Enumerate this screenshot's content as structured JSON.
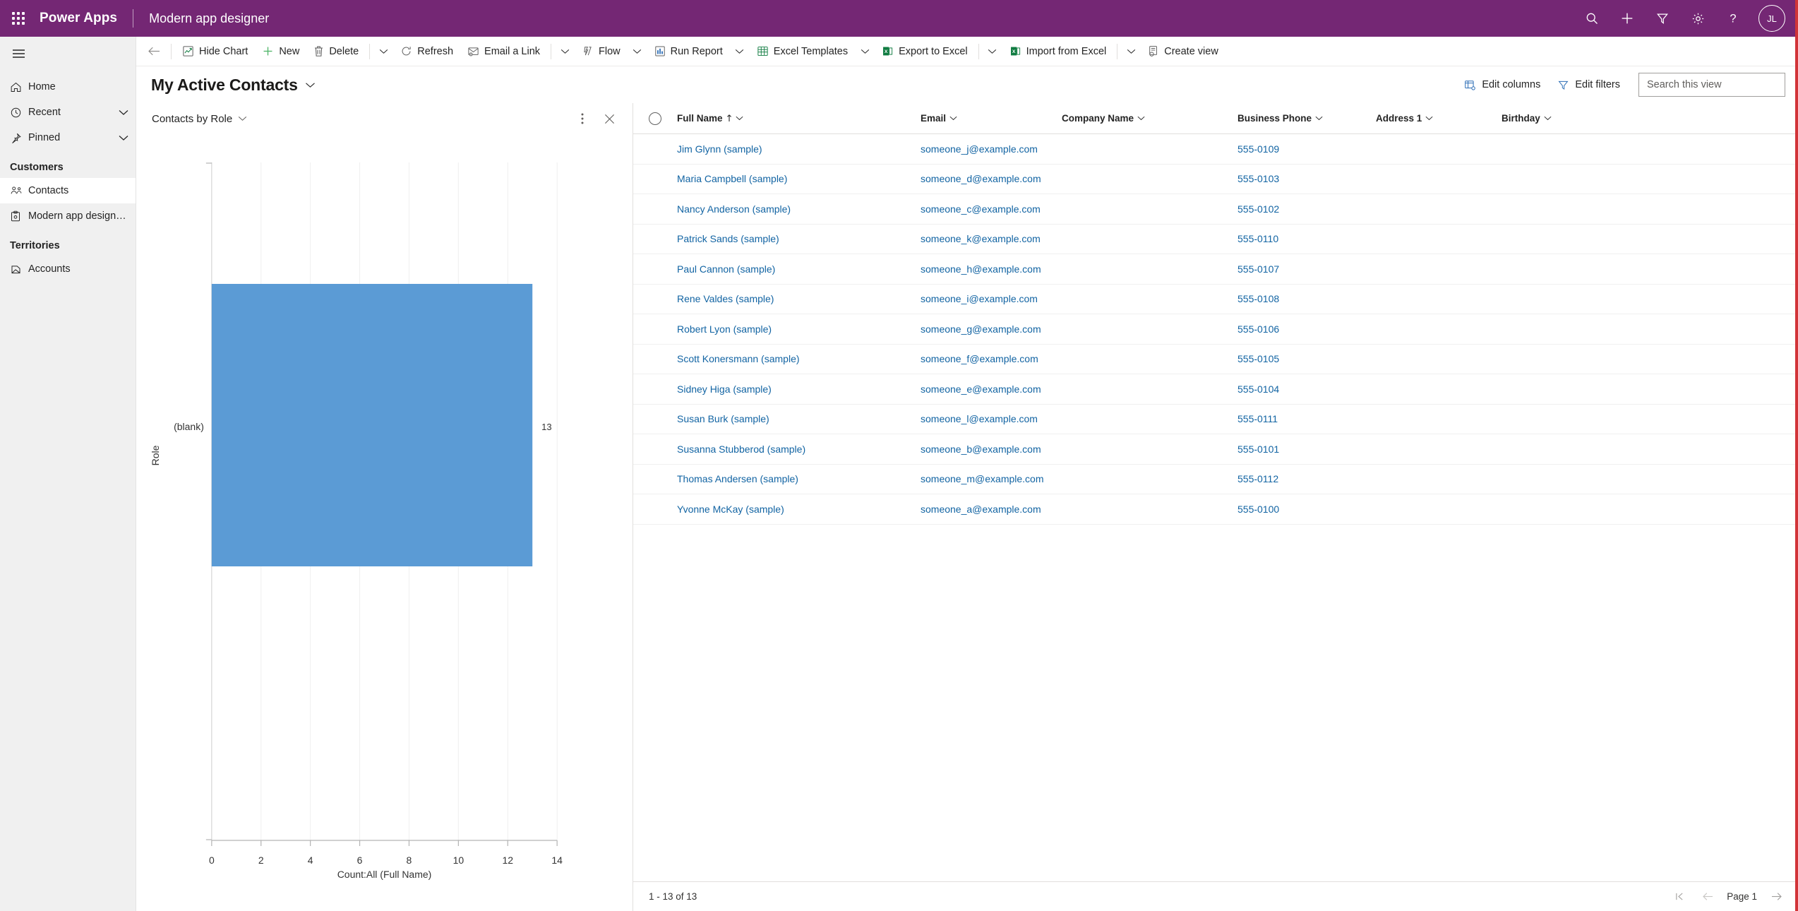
{
  "topbar": {
    "waffle_label": "app-launcher",
    "brand": "Power Apps",
    "app_name": "Modern app designer",
    "icons": [
      "search-icon",
      "plus-icon",
      "filter-icon",
      "gear-icon",
      "help-icon"
    ],
    "avatar_initials": "JL",
    "bg_color": "#742774"
  },
  "sidebar": {
    "hamburger": "site-map-toggle",
    "items": [
      {
        "label": "Home",
        "icon": "home-icon",
        "expandable": false,
        "active": false
      },
      {
        "label": "Recent",
        "icon": "clock-icon",
        "expandable": true,
        "active": false
      },
      {
        "label": "Pinned",
        "icon": "pin-icon",
        "expandable": true,
        "active": false
      }
    ],
    "groups": [
      {
        "title": "Customers",
        "items": [
          {
            "label": "Contacts",
            "icon": "contacts-icon",
            "active": true
          },
          {
            "label": "Modern app designe...",
            "icon": "clipboard-icon",
            "active": false
          }
        ]
      },
      {
        "title": "Territories",
        "items": [
          {
            "label": "Accounts",
            "icon": "accounts-icon",
            "active": false
          }
        ]
      }
    ]
  },
  "commandbar": {
    "back": "back-arrow-icon",
    "commands": [
      {
        "label": "Hide Chart",
        "icon": "chart-icon",
        "caret": false
      },
      {
        "label": "New",
        "icon": "plus-icon",
        "caret": false
      },
      {
        "label": "Delete",
        "icon": "trash-icon",
        "caret": true,
        "divider_before": false,
        "divider_after": true
      },
      {
        "label": "Refresh",
        "icon": "refresh-icon",
        "caret": false
      },
      {
        "label": "Email a Link",
        "icon": "email-link-icon",
        "caret": true
      },
      {
        "label": "Flow",
        "icon": "flow-icon",
        "caret": true
      },
      {
        "label": "Run Report",
        "icon": "report-icon",
        "caret": true
      },
      {
        "label": "Excel Templates",
        "icon": "excel-templates-icon",
        "caret": true
      },
      {
        "label": "Export to Excel",
        "icon": "excel-icon",
        "caret": true
      },
      {
        "label": "Import from Excel",
        "icon": "excel-icon",
        "caret": true
      },
      {
        "label": "Create view",
        "icon": "create-view-icon",
        "caret": false
      }
    ]
  },
  "view": {
    "title": "My Active Contacts",
    "title_caret": "chevron-down-icon",
    "edit_columns_label": "Edit columns",
    "edit_filters_label": "Edit filters",
    "search_placeholder": "Search this view",
    "search_value": ""
  },
  "chart_panel": {
    "title": "Contacts by Role",
    "title_caret": "chevron-down-icon",
    "more_icon": "more-vertical-icon",
    "close_icon": "close-icon"
  },
  "chart_data": {
    "type": "bar",
    "orientation": "horizontal",
    "title": "Contacts by Role",
    "categories": [
      "(blank)"
    ],
    "values": [
      13
    ],
    "data_labels": [
      "13"
    ],
    "xlabel": "Count:All (Full Name)",
    "ylabel": "Role",
    "xlim": [
      0,
      14
    ],
    "xticks": [
      0,
      2,
      4,
      6,
      8,
      10,
      12,
      14
    ],
    "xtick_labels": [
      "0",
      "2",
      "4",
      "6",
      "8",
      "10",
      "12",
      "14"
    ],
    "grid": true,
    "grid_axis": "x",
    "legend": false,
    "bar_color": "#5B9BD5"
  },
  "grid": {
    "select_all": "select-all-circle",
    "columns": [
      {
        "key": "full_name",
        "label": "Full Name",
        "sorted": "asc",
        "sort_icon": "sort-asc-arrow",
        "caret": "chevron-down-icon"
      },
      {
        "key": "email",
        "label": "Email",
        "caret": "chevron-down-icon"
      },
      {
        "key": "company_name",
        "label": "Company Name",
        "caret": "chevron-down-icon"
      },
      {
        "key": "business_phone",
        "label": "Business Phone",
        "caret": "chevron-down-icon"
      },
      {
        "key": "address1",
        "label": "Address 1",
        "caret": "chevron-down-icon"
      },
      {
        "key": "birthday",
        "label": "Birthday",
        "caret": "chevron-down-icon"
      }
    ],
    "rows": [
      {
        "full_name": "Jim Glynn (sample)",
        "email": "someone_j@example.com",
        "company_name": "",
        "business_phone": "555-0109",
        "address1": "",
        "birthday": ""
      },
      {
        "full_name": "Maria Campbell (sample)",
        "email": "someone_d@example.com",
        "company_name": "",
        "business_phone": "555-0103",
        "address1": "",
        "birthday": ""
      },
      {
        "full_name": "Nancy Anderson (sample)",
        "email": "someone_c@example.com",
        "company_name": "",
        "business_phone": "555-0102",
        "address1": "",
        "birthday": ""
      },
      {
        "full_name": "Patrick Sands (sample)",
        "email": "someone_k@example.com",
        "company_name": "",
        "business_phone": "555-0110",
        "address1": "",
        "birthday": ""
      },
      {
        "full_name": "Paul Cannon (sample)",
        "email": "someone_h@example.com",
        "company_name": "",
        "business_phone": "555-0107",
        "address1": "",
        "birthday": ""
      },
      {
        "full_name": "Rene Valdes (sample)",
        "email": "someone_i@example.com",
        "company_name": "",
        "business_phone": "555-0108",
        "address1": "",
        "birthday": ""
      },
      {
        "full_name": "Robert Lyon (sample)",
        "email": "someone_g@example.com",
        "company_name": "",
        "business_phone": "555-0106",
        "address1": "",
        "birthday": ""
      },
      {
        "full_name": "Scott Konersmann (sample)",
        "email": "someone_f@example.com",
        "company_name": "",
        "business_phone": "555-0105",
        "address1": "",
        "birthday": ""
      },
      {
        "full_name": "Sidney Higa (sample)",
        "email": "someone_e@example.com",
        "company_name": "",
        "business_phone": "555-0104",
        "address1": "",
        "birthday": ""
      },
      {
        "full_name": "Susan Burk (sample)",
        "email": "someone_l@example.com",
        "company_name": "",
        "business_phone": "555-0111",
        "address1": "",
        "birthday": ""
      },
      {
        "full_name": "Susanna Stubberod (sample)",
        "email": "someone_b@example.com",
        "company_name": "",
        "business_phone": "555-0101",
        "address1": "",
        "birthday": ""
      },
      {
        "full_name": "Thomas Andersen (sample)",
        "email": "someone_m@example.com",
        "company_name": "",
        "business_phone": "555-0112",
        "address1": "",
        "birthday": ""
      },
      {
        "full_name": "Yvonne McKay (sample)",
        "email": "someone_a@example.com",
        "company_name": "",
        "business_phone": "555-0100",
        "address1": "",
        "birthday": ""
      }
    ],
    "footer": {
      "count_text": "1 - 13 of 13",
      "first_page_icon": "first-page-icon",
      "prev_page_icon": "prev-page-icon",
      "page_label": "Page 1",
      "next_page_icon": "next-page-icon"
    }
  }
}
